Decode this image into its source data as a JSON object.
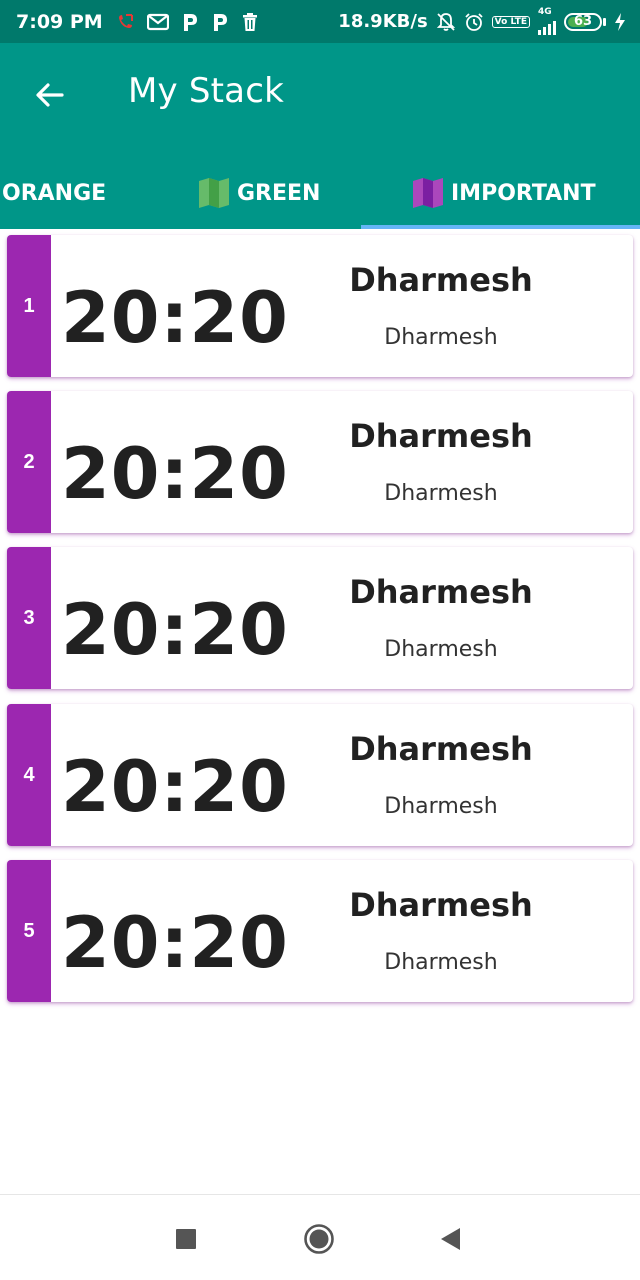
{
  "status_bar": {
    "time": "7:09 PM",
    "net_speed": "18.9KB/s",
    "network_type": "4G",
    "volte_label": "Vo LTE",
    "battery_level": "63",
    "notification_icons": [
      "missed-call-icon",
      "mail-icon",
      "p-icon",
      "p-icon",
      "trash-icon"
    ],
    "system_icons": [
      "mute-icon",
      "alarm-icon",
      "volte-icon",
      "signal-icon",
      "battery-icon",
      "charging-icon"
    ]
  },
  "app_bar": {
    "title": "My Stack",
    "back_icon": "arrow-left-icon",
    "background": "#009688"
  },
  "tabs": [
    {
      "label": "ORANGE",
      "icon": "",
      "selected": false
    },
    {
      "label": "GREEN",
      "icon": "map-icon",
      "icon_color": "#4caf50",
      "selected": false
    },
    {
      "label": "IMPORTANT",
      "icon": "map-icon",
      "icon_color": "#9c27b0",
      "selected": true
    }
  ],
  "accent_color": "#9c27b0",
  "items": [
    {
      "index": "1",
      "time": "20:20",
      "title": "Dharmesh",
      "subtitle": "Dharmesh"
    },
    {
      "index": "2",
      "time": "20:20",
      "title": "Dharmesh",
      "subtitle": "Dharmesh"
    },
    {
      "index": "3",
      "time": "20:20",
      "title": "Dharmesh",
      "subtitle": "Dharmesh"
    },
    {
      "index": "4",
      "time": "20:20",
      "title": "Dharmesh",
      "subtitle": "Dharmesh"
    },
    {
      "index": "5",
      "time": "20:20",
      "title": "Dharmesh",
      "subtitle": "Dharmesh"
    }
  ],
  "nav_bar": {
    "buttons": [
      "recents-icon",
      "home-icon",
      "back-icon"
    ]
  }
}
